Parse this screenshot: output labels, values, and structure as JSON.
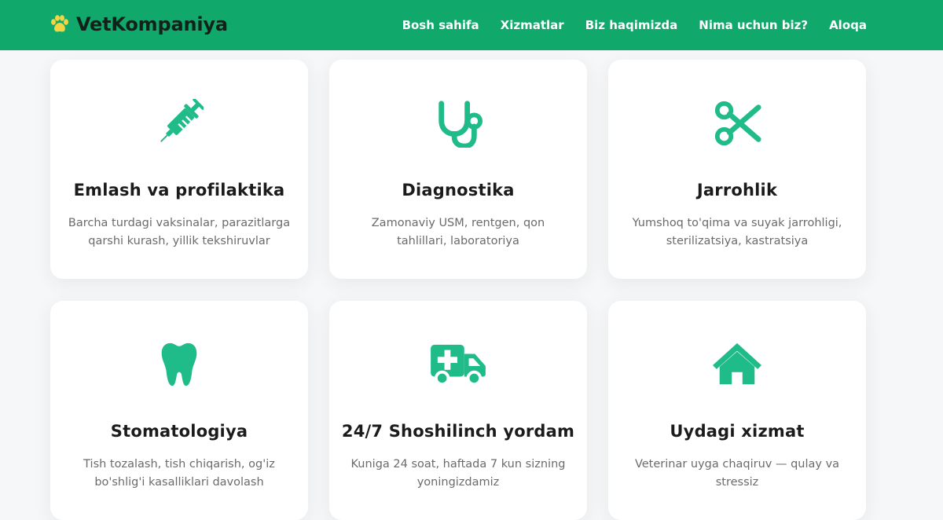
{
  "brand": {
    "name": "VetKompaniya",
    "icon": "paw-icon",
    "icon_color": "#f3d544"
  },
  "nav": [
    {
      "label": "Bosh sahifa"
    },
    {
      "label": "Xizmatlar"
    },
    {
      "label": "Biz haqimizda"
    },
    {
      "label": "Nima uchun biz?"
    },
    {
      "label": "Aloqa"
    }
  ],
  "colors": {
    "primary": "#10a96b",
    "icon": "#1fbb88",
    "title": "#1b1b1b",
    "text": "#6b6b6b"
  },
  "services": [
    {
      "icon": "syringe-icon",
      "title": "Emlash va profilaktika",
      "description": "Barcha turdagi vaksinalar, parazitlarga qarshi kurash, yillik tekshiruvlar"
    },
    {
      "icon": "stethoscope-icon",
      "title": "Diagnostika",
      "description": "Zamonaviy USM, rentgen, qon tahlillari, laboratoriya"
    },
    {
      "icon": "scissors-icon",
      "title": "Jarrohlik",
      "description": "Yumshoq to'qima va suyak jarrohligi, sterilizatsiya, kastratsiya"
    },
    {
      "icon": "tooth-icon",
      "title": "Stomatologiya",
      "description": "Tish tozalash, tish chiqarish, og'iz bo'shlig'i kasalliklari davolash"
    },
    {
      "icon": "ambulance-icon",
      "title": "24/7 Shoshilinch yordam",
      "description": "Kuniga 24 soat, haftada 7 kun sizning yoningizdamiz"
    },
    {
      "icon": "home-icon",
      "title": "Uydagi xizmat",
      "description": "Veterinar uyga chaqiruv — qulay va stressiz"
    }
  ]
}
